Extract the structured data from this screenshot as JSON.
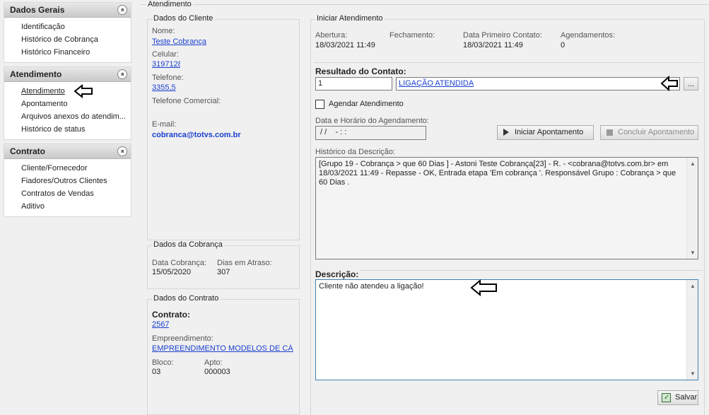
{
  "sidebar": {
    "sections": [
      {
        "title": "Dados Gerais",
        "items": [
          "Identificação",
          "Histórico de Cobrança",
          "Histórico Financeiro"
        ]
      },
      {
        "title": "Atendimento",
        "items": [
          "Atendimento",
          "Apontamento",
          "Arquivos anexos do atendim...",
          "Histórico de status"
        ]
      },
      {
        "title": "Contrato",
        "items": [
          "Cliente/Fornecedor",
          "Fiadores/Outros Clientes",
          "Contratos de Vendas",
          "Aditivo"
        ]
      }
    ],
    "collapse_glyph": "«"
  },
  "main": {
    "title": "Atendimento"
  },
  "cliente": {
    "title": "Dados do Cliente",
    "nome_label": "Nome:",
    "nome": "Teste Cobrança",
    "celular_label": "Celular:",
    "celular": "3197128",
    "telefone_label": "Telefone:",
    "telefone": "3355,5",
    "telefone_comercial_label": "Telefone Comercial:",
    "email_label": "E-mail:",
    "email": "cobranca@totvs.com.br"
  },
  "cobranca": {
    "title": "Dados da Cobrança",
    "data_label": "Data Cobrança:",
    "data": "15/05/2020",
    "dias_label": "Dias em Atraso:",
    "dias": "307"
  },
  "contrato": {
    "title": "Dados do Contrato",
    "contrato_label": "Contrato:",
    "contrato": "2567",
    "empreendimento_label": "Empreendimento:",
    "empreendimento": "EMPREENDIMENTO MODELOS DE CÁLC",
    "bloco_label": "Bloco:",
    "bloco": "03",
    "apto_label": "Apto:",
    "apto": "000003"
  },
  "atendimento": {
    "title": "Iniciar Atendimento",
    "abertura_label": "Abertura:",
    "abertura": "18/03/2021 11:49",
    "fechamento_label": "Fechamento:",
    "primeiro_contato_label": "Data Primeiro Contato:",
    "primeiro_contato": "18/03/2021 11:49",
    "agendamentos_label": "Agendamentos:",
    "agendamentos": "0",
    "resultado_label": "Resultado do Contato:",
    "resultado_codigo": "1",
    "resultado_descricao": "LIGAÇÃO ATENDIDA",
    "lookup_button": "...",
    "agendar_label": "Agendar Atendimento",
    "agendamento_label": "Data e Horário do Agendamento:",
    "agendamento_value": " / /    - : :",
    "iniciar_button": "Iniciar Apontamento",
    "concluir_button": "Concluir Apontamento",
    "historico_label": "Histórico da Descrição:",
    "historico_text": "[Grupo 19 - Cobrança > que 60 Dias ] - Astoni Teste Cobrança[23] - R. - <cobrana@totvs.com.br> em 18/03/2021 11:49 - Repasse - OK, Entrada etapa 'Em cobrança '. Responsável Grupo : Cobrança > que 60 Dias .",
    "descricao_label": "Descrição:",
    "descricao_text": "Cliente não atendeu a ligação!",
    "salvar_button": "Salvar"
  },
  "colors": {
    "link": "#1a3fcf",
    "panel": "#f0f0f0",
    "header_gradient_top": "#e8e8e8",
    "header_gradient_bottom": "#c9c9c9"
  }
}
